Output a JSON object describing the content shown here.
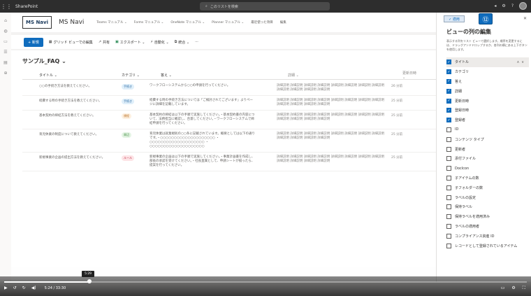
{
  "suite": {
    "app_name": "SharePoint",
    "search_placeholder": "このリストを検索"
  },
  "site": {
    "logo_text": "MS Navi",
    "name": "MS Navi",
    "nav": [
      "Teams マニュアル ⌄",
      "Forms マニュアル ⌄",
      "OneNote マニュアル ⌄",
      "Planner マニュアル ⌄",
      "最近使った項目",
      "編集"
    ]
  },
  "commands": {
    "new": "+ 新規",
    "grid_edit": "グリッド ビューでの編集",
    "share": "共有",
    "export": "エクスポート ⌄",
    "automate": "自動化 ⌄",
    "integrate": "統合 ⌄",
    "more": "···"
  },
  "list": {
    "title": "サンプル_FAQ ⌄",
    "columns": [
      "タイトル ⌄",
      "カテゴリ ⌄",
      "答え ⌄",
      "詳細 ⌄",
      "更新日時 ⌄"
    ],
    "rows": [
      {
        "title": "○○の手続き方法を教えてください。",
        "category": "手続き",
        "cat_bg": "#e0effa",
        "cat_fg": "#2b6ca3",
        "answer": "ワークフローシステムから○○の申請を行ってください。",
        "detail": "詳細説明 詳細説明 詳細説明 詳細説明 詳細説明 詳細説明 詳細説明 詳細説明 詳細説明 詳細説明 詳細説明 詳細説明",
        "updated": "26 分前"
      },
      {
        "title": "経費する時の手続き方法を教えてください。",
        "category": "手続き",
        "cat_bg": "#e0effa",
        "cat_fg": "#2b6ca3",
        "answer": "経費する時の手続き方法については「ご検討されてございます」よりページに詳細を記載しています。",
        "detail": "詳細説明 詳細説明 詳細説明 詳細説明 詳細説明 詳細説明 詳細説明 詳細説明 詳細説明 詳細説明 詳細説明 詳細説明",
        "updated": "25 分前"
      },
      {
        "title": "基本契約の締結方法を教えてください。",
        "category": "規程",
        "cat_bg": "#fdf0e0",
        "cat_fg": "#b86b1e",
        "answer": "基本契約の締結は以下の手順で実施してください。・基本契約書の内容について、法務担当に確認し、合意してください。・ワークフローシステムで締結申請を行ってください。",
        "detail": "詳細説明 詳細説明 詳細説明 詳細説明 詳細説明 詳細説明 詳細説明 詳細説明 詳細説明 詳細説明 詳細説明 詳細説明",
        "updated": "25 分前"
      },
      {
        "title": "育児休業の制度について教えてください。",
        "category": "周辺",
        "cat_bg": "#e4f4e4",
        "cat_fg": "#3c8a3c",
        "answer": "育児休業は就業規則の○○条に記載されています。概要としては以下の通りです。・○○○○○○○○○○○○○○○○○○○○ ・○○○○○○○○○○○○○○○○○○○○ ・○○○○○○○○○○○○○○○○○○○○",
        "detail": "詳細説明 詳細説明 詳細説明 詳細説明 詳細説明 詳細説明 詳細説明 詳細説明 詳細説明 詳細説明 詳細説明 詳細説明",
        "updated": "25 分前"
      },
      {
        "title": "新規事業の企画の提出方法を教えてください。",
        "category": "ルール",
        "cat_bg": "#fde4e6",
        "cat_fg": "#c4314b",
        "answer": "新規事業の企画は以下の手順で実施してください。・事業計画書を作成し、部長の承認を受けてください。・社長直属として、申請シートが揃ったら、提案を行ってください。",
        "detail": "詳細説明 詳細説明 詳細説明 詳細説明 詳細説明 詳細説明 詳細説明 詳細説明 詳細説明 詳細説明 詳細説明 詳細説明",
        "updated": "25 分前"
      }
    ]
  },
  "panel": {
    "apply": "✓ 適用",
    "step": "⑫",
    "title": "ビューの列の編集",
    "description": "表示する列をリスト ビューで選択します。順序を変更するには、ドラッグアンドドロップするか、各列の横にある上下ボタンを使用します。",
    "items": [
      {
        "label": "タイトル",
        "checked": true,
        "selected": true
      },
      {
        "label": "カテゴリ",
        "checked": true
      },
      {
        "label": "答え",
        "checked": true
      },
      {
        "label": "詳細",
        "checked": true
      },
      {
        "label": "更新日時",
        "checked": true
      },
      {
        "label": "登録日時",
        "checked": true
      },
      {
        "label": "登録者",
        "checked": true
      },
      {
        "label": "ID",
        "checked": false
      },
      {
        "label": "コンテンツ タイプ",
        "checked": false
      },
      {
        "label": "更新者",
        "checked": false
      },
      {
        "label": "添付ファイル",
        "checked": false
      },
      {
        "label": "DocIcon",
        "checked": false
      },
      {
        "label": "子アイテムの数",
        "checked": false
      },
      {
        "label": "子フォルダーの数",
        "checked": false
      },
      {
        "label": "ラベルの設定",
        "checked": false
      },
      {
        "label": "保持ラベル",
        "checked": false
      },
      {
        "label": "保持ラベルを適用済み",
        "checked": false
      },
      {
        "label": "ラベルの適用者",
        "checked": false
      },
      {
        "label": "コンプライアンス資産 ID",
        "checked": false
      },
      {
        "label": "レコードとして登録されているアイテム",
        "checked": false
      }
    ]
  },
  "player": {
    "tooltip": "5:29",
    "time": "5:24 / 33:30",
    "progress_percent": 16.3
  }
}
